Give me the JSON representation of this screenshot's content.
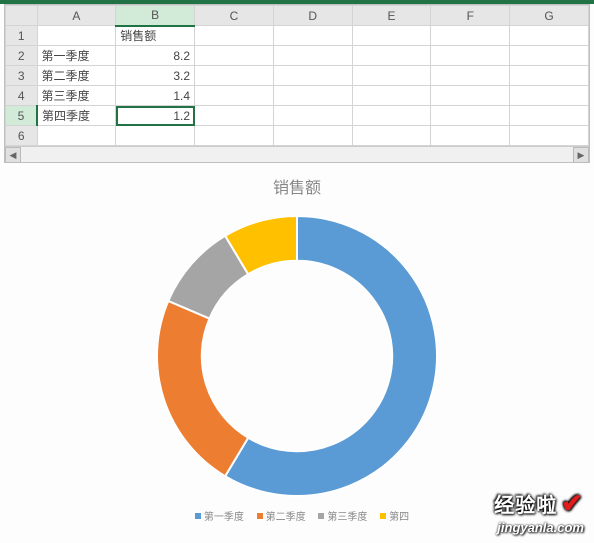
{
  "columns": [
    "A",
    "B",
    "C",
    "D",
    "E",
    "F",
    "G"
  ],
  "rows": [
    "1",
    "2",
    "3",
    "4",
    "5",
    "6"
  ],
  "cells": {
    "B1": "销售额",
    "A2": "第一季度",
    "B2": "8.2",
    "A3": "第二季度",
    "B3": "3.2",
    "A4": "第三季度",
    "B4": "1.4",
    "A5": "第四季度",
    "B5": "1.2"
  },
  "active_cell": "B5",
  "chart_title": "销售额",
  "legend": {
    "s1": "第一季度",
    "s2": "第二季度",
    "s3": "第三季度",
    "s4": "第四"
  },
  "colors": {
    "s1": "#5b9bd5",
    "s2": "#ed7d31",
    "s3": "#a5a5a5",
    "s4": "#ffc000"
  },
  "watermark_text": "经验啦",
  "watermark_url": "jingyanla.com",
  "chart_data": {
    "type": "pie",
    "title": "销售额",
    "categories": [
      "第一季度",
      "第二季度",
      "第三季度",
      "第四季度"
    ],
    "values": [
      8.2,
      3.2,
      1.4,
      1.2
    ],
    "colors": [
      "#5b9bd5",
      "#ed7d31",
      "#a5a5a5",
      "#ffc000"
    ],
    "donut_inner_ratio": 0.68
  }
}
